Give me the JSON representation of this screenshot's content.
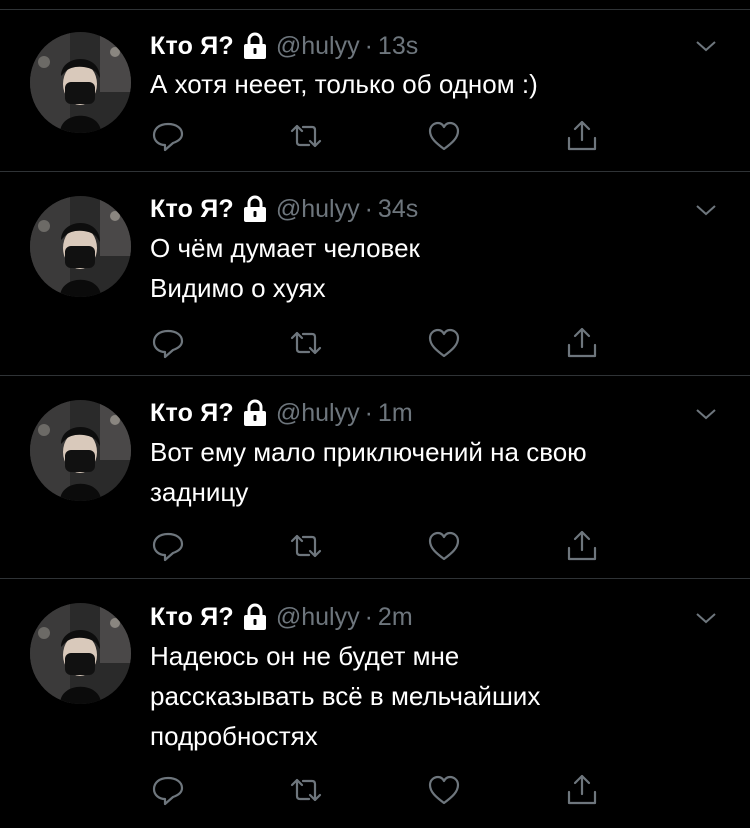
{
  "tweets": [
    {
      "name": "Кто Я?",
      "handle": "@hulyy",
      "separator": "·",
      "time": "13s",
      "lines": [
        "А хотя нееет, только об одном :)"
      ]
    },
    {
      "name": "Кто Я?",
      "handle": "@hulyy",
      "separator": "·",
      "time": "34s",
      "lines": [
        "О чём думает человек",
        "Видимо о хуях"
      ]
    },
    {
      "name": "Кто Я?",
      "handle": "@hulyy",
      "separator": "·",
      "time": "1m",
      "lines": [
        "Вот ему мало приключений на свою",
        "задницу"
      ]
    },
    {
      "name": "Кто Я?",
      "handle": "@hulyy",
      "separator": "·",
      "time": "2m",
      "lines": [
        "Надеюсь он не будет мне",
        "рассказывать всё в мельчайших",
        "подробностях"
      ]
    }
  ],
  "icons": {
    "lock": "lock-icon",
    "more": "chevron-down-icon",
    "reply": "reply-icon",
    "retweet": "retweet-icon",
    "like": "heart-icon",
    "share": "share-icon"
  },
  "colors": {
    "background": "#000000",
    "text": "#ffffff",
    "secondary": "#6e767d",
    "divider": "#2f3336"
  }
}
